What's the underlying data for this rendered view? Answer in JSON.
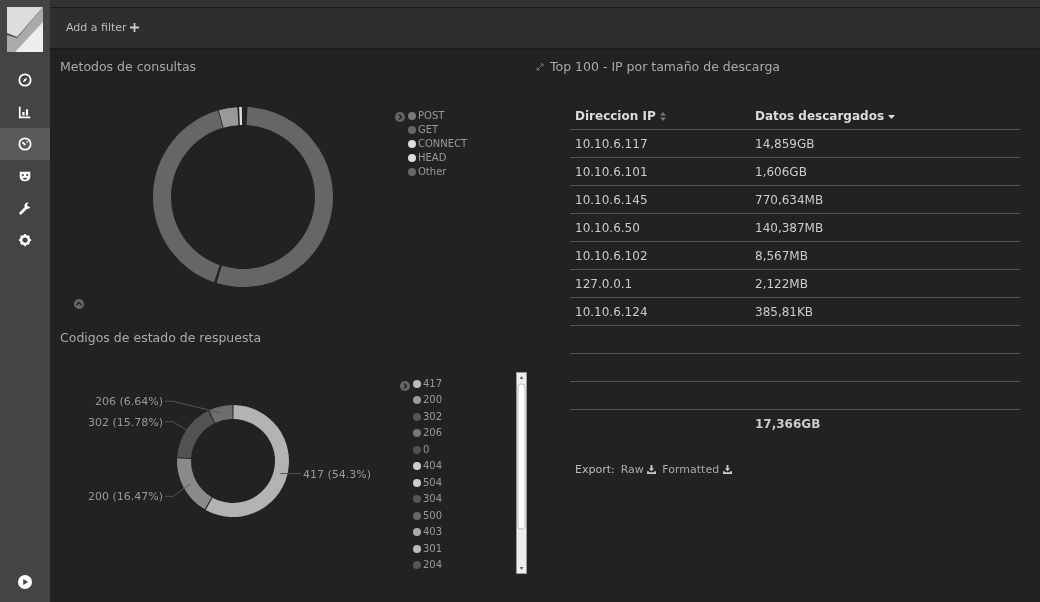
{
  "sidebar": {
    "items": [
      {
        "kind": "compass",
        "selected": false
      },
      {
        "kind": "bar-chart",
        "selected": false
      },
      {
        "kind": "gauge",
        "selected": true
      },
      {
        "kind": "mask",
        "selected": false
      },
      {
        "kind": "wrench",
        "selected": false
      },
      {
        "kind": "gear",
        "selected": false
      }
    ]
  },
  "filter_bar": {
    "label": "Add a filter"
  },
  "methods_panel": {
    "title": "Metodos de consultas",
    "legend": [
      {
        "label": "POST",
        "color": "#7a7a7a"
      },
      {
        "label": "GET",
        "color": "#666666"
      },
      {
        "label": "CONNECT",
        "color": "#dddddd"
      },
      {
        "label": "HEAD",
        "color": "#dddddd"
      },
      {
        "label": "Other",
        "color": "#666666"
      }
    ]
  },
  "status_panel": {
    "title": "Codigos de estado de respuesta",
    "chart_data": {
      "type": "donut",
      "categories": [
        "417 (54.3%)",
        "200 (16.47%)",
        "302 (15.78%)",
        "206 (6.64%)"
      ],
      "values": [
        54.3,
        16.47,
        15.78,
        6.64
      ]
    },
    "legend": [
      {
        "label": "417",
        "color": "#bbbbbb"
      },
      {
        "label": "200",
        "color": "#999999"
      },
      {
        "label": "302",
        "color": "#555555"
      },
      {
        "label": "206",
        "color": "#777777"
      },
      {
        "label": "0",
        "color": "#505050"
      },
      {
        "label": "404",
        "color": "#cccccc"
      },
      {
        "label": "504",
        "color": "#cccccc"
      },
      {
        "label": "304",
        "color": "#555555"
      },
      {
        "label": "500",
        "color": "#666666"
      },
      {
        "label": "403",
        "color": "#aaaaaa"
      },
      {
        "label": "301",
        "color": "#bbbbbb"
      },
      {
        "label": "204",
        "color": "#555555"
      }
    ]
  },
  "table_panel": {
    "title": "Top 100 - IP por tamaño de descarga",
    "columns": [
      {
        "label": "Direccion IP",
        "sorted": false
      },
      {
        "label": "Datos descargados",
        "sorted": true
      }
    ],
    "rows": [
      [
        "10.10.6.117",
        "14,859GB"
      ],
      [
        "10.10.6.101",
        "1,606GB"
      ],
      [
        "10.10.6.145",
        "770,634MB"
      ],
      [
        "10.10.6.50",
        "140,387MB"
      ],
      [
        "10.10.6.102",
        "8,567MB"
      ],
      [
        "127.0.0.1",
        "2,122MB"
      ],
      [
        "10.10.6.124",
        "385,81KB"
      ]
    ],
    "total": "17,366GB",
    "export": {
      "label": "Export:",
      "links": [
        "Raw",
        "Formatted"
      ]
    }
  }
}
